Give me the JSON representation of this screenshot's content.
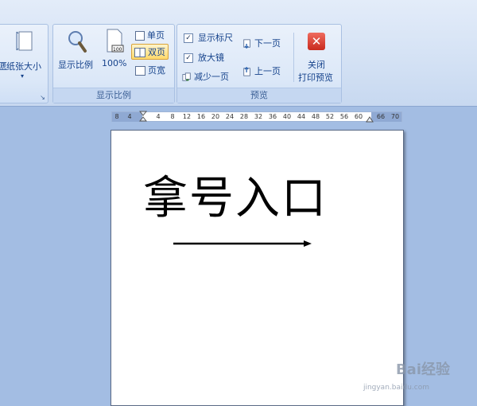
{
  "ribbon": {
    "paper_size_label": "纸张大小",
    "zoom_group": {
      "label": "显示比例",
      "zoom_button": "显示比例",
      "percent_button": "100%",
      "single_page": "单页",
      "two_pages": "双页",
      "page_width": "页宽"
    },
    "preview_group": {
      "label": "预览",
      "show_ruler": "显示标尺",
      "show_ruler_checked": true,
      "magnifier": "放大镜",
      "magnifier_checked": true,
      "shrink_one_page": "减少一页",
      "next_page": "下一页",
      "prev_page": "上一页",
      "close_line1": "关闭",
      "close_line2": "打印预览"
    }
  },
  "ruler": {
    "ticks": [
      "8",
      "4",
      "4",
      "8",
      "12",
      "16",
      "20",
      "24",
      "28",
      "32",
      "36",
      "40",
      "44",
      "48",
      "52",
      "56",
      "60",
      "66",
      "70"
    ]
  },
  "document": {
    "text": "拿号入口"
  },
  "watermark": {
    "brand": "Bai经验",
    "url": "jingyan.baidu.com"
  },
  "colors": {
    "ribbon_text": "#15428b",
    "workspace": "#a3bde3",
    "close_button": "#d9372b"
  }
}
